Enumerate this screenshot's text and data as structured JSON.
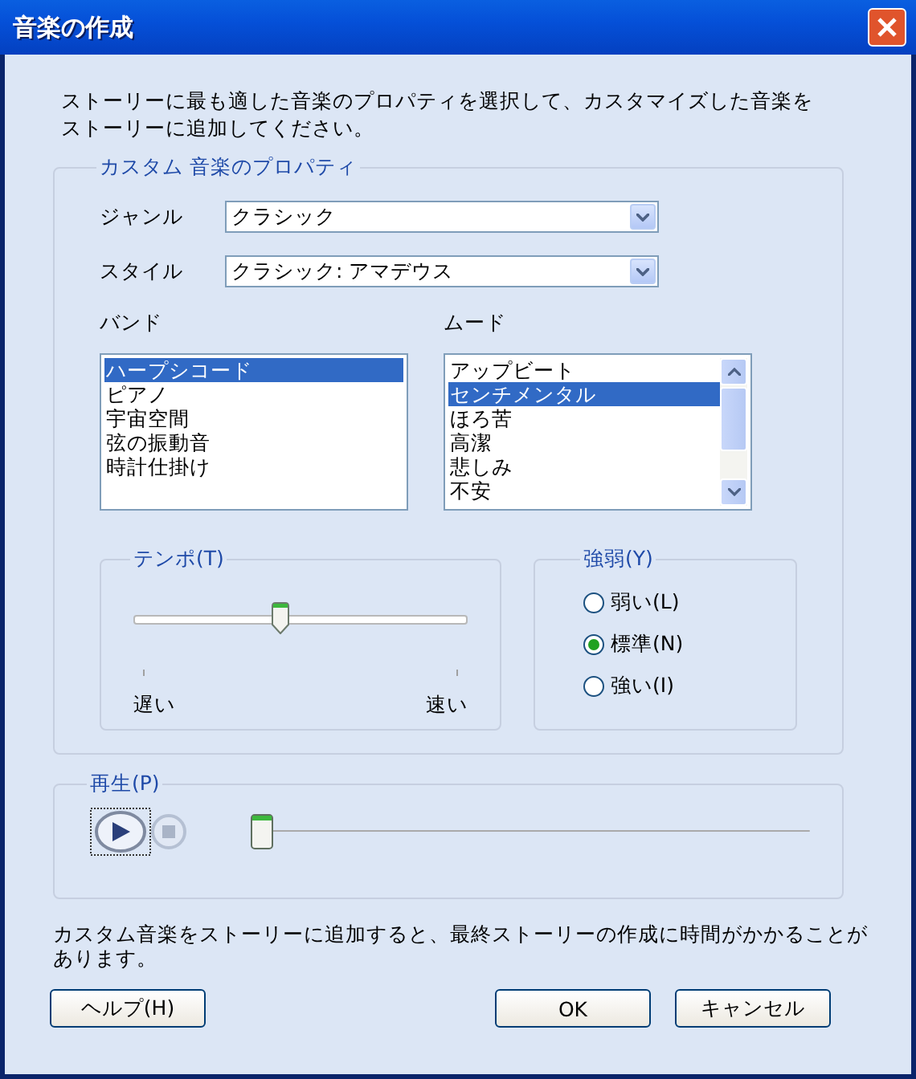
{
  "window": {
    "title": "音楽の作成"
  },
  "intro": "ストーリーに最も適した音楽のプロパティを選択して、カスタマイズした音楽をストーリーに追加してください。",
  "properties": {
    "title": "カスタム 音楽のプロパティ",
    "genre": {
      "label": "ジャンル",
      "value": "クラシック"
    },
    "style": {
      "label": "スタイル",
      "value": "クラシック: アマデウス"
    },
    "band": {
      "label": "バンド",
      "items": [
        {
          "label": "ハープシコード",
          "selected": true
        },
        {
          "label": "ピアノ",
          "selected": false
        },
        {
          "label": "宇宙空間",
          "selected": false
        },
        {
          "label": "弦の振動音",
          "selected": false
        },
        {
          "label": "時計仕掛け",
          "selected": false
        }
      ]
    },
    "mood": {
      "label": "ムード",
      "items": [
        {
          "label": "アップビート",
          "selected": false
        },
        {
          "label": "センチメンタル",
          "selected": true
        },
        {
          "label": "ほろ苦",
          "selected": false
        },
        {
          "label": "高潔",
          "selected": false
        },
        {
          "label": "悲しみ",
          "selected": false
        },
        {
          "label": "不安",
          "selected": false
        }
      ]
    },
    "tempo": {
      "title": "テンポ(T)",
      "level": 0.44,
      "min_label": "遅い",
      "max_label": "速い"
    },
    "dynamics": {
      "title": "強弱(Y)",
      "options": [
        {
          "label": "弱い(L)",
          "selected": false
        },
        {
          "label": "標準(N)",
          "selected": true
        },
        {
          "label": "強い(I)",
          "selected": false
        }
      ]
    }
  },
  "playback": {
    "title": "再生(P)",
    "level": 0,
    "stop": {
      "disabled": true
    }
  },
  "note": "カスタム音楽をストーリーに追加すると、最終ストーリーの作成に時間がかかることがあります。",
  "buttons": [
    {
      "label": "ヘルプ(H)"
    },
    {
      "label": "OK"
    },
    {
      "label": "キャンセル"
    }
  ]
}
